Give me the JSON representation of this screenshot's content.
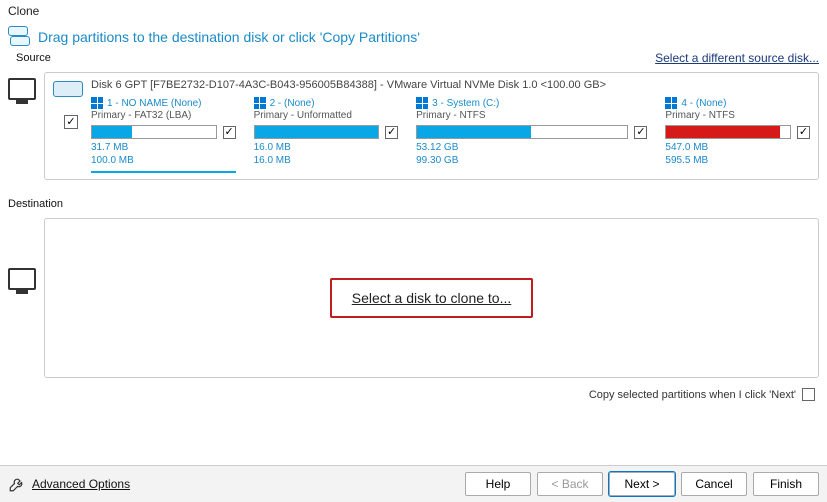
{
  "title": "Clone",
  "instruction": "Drag partitions to the destination disk or click 'Copy Partitions'",
  "source": {
    "label": "Source",
    "select_other": "Select a different source disk...",
    "disk_title": "Disk 6 GPT [F7BE2732-D107-4A3C-B043-956005B84388] - VMware Virtual NVMe Disk 1.0  <100.00 GB>",
    "partitions": [
      {
        "num": "1",
        "name": "NO NAME",
        "scope": "(None)",
        "type": "Primary - FAT32 (LBA)",
        "used": "31.7 MB",
        "total": "100.0 MB",
        "fill": 32,
        "color": "blue",
        "checked": true,
        "active": true
      },
      {
        "num": "2",
        "name": "",
        "scope": "(None)",
        "type": "Primary - Unformatted",
        "used": "16.0 MB",
        "total": "16.0 MB",
        "fill": 100,
        "color": "blue",
        "checked": true,
        "active": false
      },
      {
        "num": "3",
        "name": "System",
        "scope": "(C:)",
        "type": "Primary - NTFS",
        "used": "53.12 GB",
        "total": "99.30 GB",
        "fill": 54,
        "color": "blue",
        "checked": true,
        "active": false
      },
      {
        "num": "4",
        "name": "",
        "scope": "(None)",
        "type": "Primary - NTFS",
        "used": "547.0 MB",
        "total": "595.5 MB",
        "fill": 92,
        "color": "red",
        "checked": true,
        "active": false
      }
    ]
  },
  "destination": {
    "label": "Destination",
    "select_link": "Select a disk to clone to..."
  },
  "copy_option": {
    "label": "Copy selected partitions when I click 'Next'",
    "checked": false
  },
  "footer": {
    "advanced": "Advanced Options",
    "help": "Help",
    "back": "< Back",
    "next": "Next >",
    "cancel": "Cancel",
    "finish": "Finish"
  }
}
